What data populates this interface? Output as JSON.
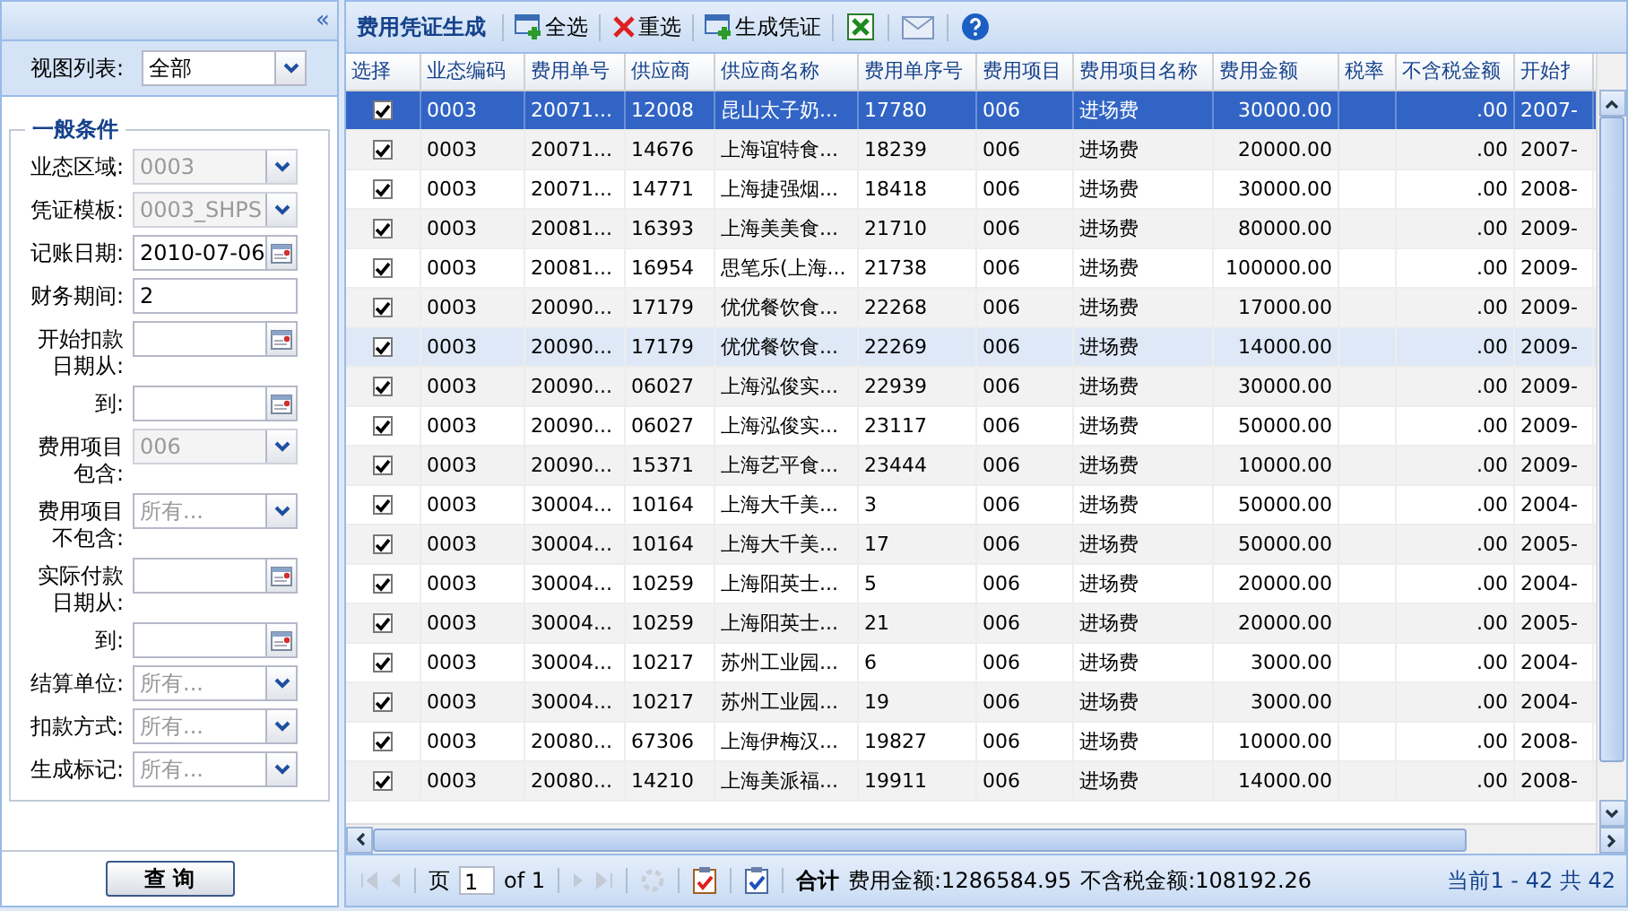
{
  "filter_panel": {
    "collapse_glyph": "«",
    "view_list": {
      "label": "视图列表:",
      "value": "全部"
    },
    "legend": "一般条件",
    "fields": [
      {
        "kind": "select",
        "label": [
          "业态区域:"
        ],
        "value": "0003",
        "disabled": true
      },
      {
        "kind": "select",
        "label": [
          "凭证模板:"
        ],
        "value": "0003_SHPS",
        "disabled": true
      },
      {
        "kind": "date",
        "label": [
          "记账日期:"
        ],
        "value": "2010-07-06"
      },
      {
        "kind": "text",
        "label": [
          "财务期间:"
        ],
        "value": "2"
      },
      {
        "kind": "date",
        "label": [
          "开始扣款",
          "日期从:"
        ]
      },
      {
        "kind": "date",
        "label": [
          "到:"
        ]
      },
      {
        "kind": "select",
        "label": [
          "费用项目",
          "包含:"
        ],
        "value": "006",
        "disabled": true
      },
      {
        "kind": "select",
        "label": [
          "费用项目",
          "不包含:"
        ],
        "placeholder": "所有...",
        "disabled": false
      },
      {
        "kind": "date",
        "label": [
          "实际付款",
          "日期从:"
        ]
      },
      {
        "kind": "date",
        "label": [
          "到:"
        ]
      },
      {
        "kind": "select",
        "label": [
          "结算单位:"
        ],
        "placeholder": "所有...",
        "disabled": false
      },
      {
        "kind": "select",
        "label": [
          "扣款方式:"
        ],
        "placeholder": "所有...",
        "disabled": false
      },
      {
        "kind": "select",
        "label": [
          "生成标记:"
        ],
        "placeholder": "所有...",
        "disabled": false
      }
    ],
    "query_button": "查 询"
  },
  "grid": {
    "title": "费用凭证生成",
    "toolbar": [
      {
        "kind": "add",
        "label": "全选"
      },
      {
        "kind": "clear",
        "label": "重选"
      },
      {
        "kind": "generate",
        "label": "生成凭证"
      },
      {
        "kind": "excel"
      },
      {
        "kind": "mail"
      },
      {
        "kind": "help"
      }
    ],
    "columns": [
      {
        "kind": "checkbox",
        "label": "选择"
      },
      {
        "kind": "text",
        "label": "业态编码"
      },
      {
        "kind": "text",
        "label": "费用单号"
      },
      {
        "kind": "text",
        "label": "供应商"
      },
      {
        "kind": "text",
        "label": "供应商名称"
      },
      {
        "kind": "text",
        "label": "费用单序号"
      },
      {
        "kind": "text",
        "label": "费用项目"
      },
      {
        "kind": "text",
        "label": "费用项目名称"
      },
      {
        "kind": "number",
        "label": "费用金额"
      },
      {
        "kind": "number",
        "label": "税率"
      },
      {
        "kind": "number",
        "label": "不含税金额"
      },
      {
        "kind": "text",
        "label": "开始扌"
      }
    ],
    "rows": [
      {
        "checked": true,
        "selected": true,
        "hovered": false,
        "cells": [
          "",
          "0003",
          "20071...",
          "12008",
          "昆山太子奶...",
          "17780",
          "006",
          "进场费",
          "30000.00",
          "",
          ".00",
          "2007-"
        ]
      },
      {
        "checked": true,
        "selected": false,
        "hovered": false,
        "cells": [
          "",
          "0003",
          "20071...",
          "14676",
          "上海谊特食...",
          "18239",
          "006",
          "进场费",
          "20000.00",
          "",
          ".00",
          "2007-"
        ]
      },
      {
        "checked": true,
        "selected": false,
        "hovered": false,
        "cells": [
          "",
          "0003",
          "20071...",
          "14771",
          "上海捷强烟...",
          "18418",
          "006",
          "进场费",
          "30000.00",
          "",
          ".00",
          "2008-"
        ]
      },
      {
        "checked": true,
        "selected": false,
        "hovered": false,
        "cells": [
          "",
          "0003",
          "20081...",
          "16393",
          "上海美美食...",
          "21710",
          "006",
          "进场费",
          "80000.00",
          "",
          ".00",
          "2009-"
        ]
      },
      {
        "checked": true,
        "selected": false,
        "hovered": false,
        "cells": [
          "",
          "0003",
          "20081...",
          "16954",
          "思笔乐(上海...",
          "21738",
          "006",
          "进场费",
          "100000.00",
          "",
          ".00",
          "2009-"
        ]
      },
      {
        "checked": true,
        "selected": false,
        "hovered": false,
        "cells": [
          "",
          "0003",
          "20090...",
          "17179",
          "优优餐饮食...",
          "22268",
          "006",
          "进场费",
          "17000.00",
          "",
          ".00",
          "2009-"
        ]
      },
      {
        "checked": true,
        "selected": false,
        "hovered": true,
        "cells": [
          "",
          "0003",
          "20090...",
          "17179",
          "优优餐饮食...",
          "22269",
          "006",
          "进场费",
          "14000.00",
          "",
          ".00",
          "2009-"
        ]
      },
      {
        "checked": true,
        "selected": false,
        "hovered": false,
        "cells": [
          "",
          "0003",
          "20090...",
          "06027",
          "上海泓俊实...",
          "22939",
          "006",
          "进场费",
          "30000.00",
          "",
          ".00",
          "2009-"
        ]
      },
      {
        "checked": true,
        "selected": false,
        "hovered": false,
        "cells": [
          "",
          "0003",
          "20090...",
          "06027",
          "上海泓俊实...",
          "23117",
          "006",
          "进场费",
          "50000.00",
          "",
          ".00",
          "2009-"
        ]
      },
      {
        "checked": true,
        "selected": false,
        "hovered": false,
        "cells": [
          "",
          "0003",
          "20090...",
          "15371",
          "上海艺平食...",
          "23444",
          "006",
          "进场费",
          "10000.00",
          "",
          ".00",
          "2009-"
        ]
      },
      {
        "checked": true,
        "selected": false,
        "hovered": false,
        "cells": [
          "",
          "0003",
          "30004...",
          "10164",
          "上海大千美...",
          "3",
          "006",
          "进场费",
          "50000.00",
          "",
          ".00",
          "2004-"
        ]
      },
      {
        "checked": true,
        "selected": false,
        "hovered": false,
        "cells": [
          "",
          "0003",
          "30004...",
          "10164",
          "上海大千美...",
          "17",
          "006",
          "进场费",
          "50000.00",
          "",
          ".00",
          "2005-"
        ]
      },
      {
        "checked": true,
        "selected": false,
        "hovered": false,
        "cells": [
          "",
          "0003",
          "30004...",
          "10259",
          "上海阳英士...",
          "5",
          "006",
          "进场费",
          "20000.00",
          "",
          ".00",
          "2004-"
        ]
      },
      {
        "checked": true,
        "selected": false,
        "hovered": false,
        "cells": [
          "",
          "0003",
          "30004...",
          "10259",
          "上海阳英士...",
          "21",
          "006",
          "进场费",
          "20000.00",
          "",
          ".00",
          "2005-"
        ]
      },
      {
        "checked": true,
        "selected": false,
        "hovered": false,
        "cells": [
          "",
          "0003",
          "30004...",
          "10217",
          "苏州工业园...",
          "6",
          "006",
          "进场费",
          "3000.00",
          "",
          ".00",
          "2004-"
        ]
      },
      {
        "checked": true,
        "selected": false,
        "hovered": false,
        "cells": [
          "",
          "0003",
          "30004...",
          "10217",
          "苏州工业园...",
          "19",
          "006",
          "进场费",
          "3000.00",
          "",
          ".00",
          "2004-"
        ]
      },
      {
        "checked": true,
        "selected": false,
        "hovered": false,
        "cells": [
          "",
          "0003",
          "20080...",
          "67306",
          "上海伊梅汉...",
          "19827",
          "006",
          "进场费",
          "10000.00",
          "",
          ".00",
          "2008-"
        ]
      },
      {
        "checked": true,
        "selected": false,
        "hovered": false,
        "cells": [
          "",
          "0003",
          "20080...",
          "14210",
          "上海美派福...",
          "19911",
          "006",
          "进场费",
          "14000.00",
          "",
          ".00",
          "2008-"
        ]
      }
    ],
    "paging": {
      "page_label": "页",
      "page": "1",
      "of": "of 1",
      "total_label": "合计",
      "amount_total": "费用金额:1286584.95",
      "net_total": "不含税金额:108192.26",
      "range": "当前1 - 42 共 42"
    }
  }
}
